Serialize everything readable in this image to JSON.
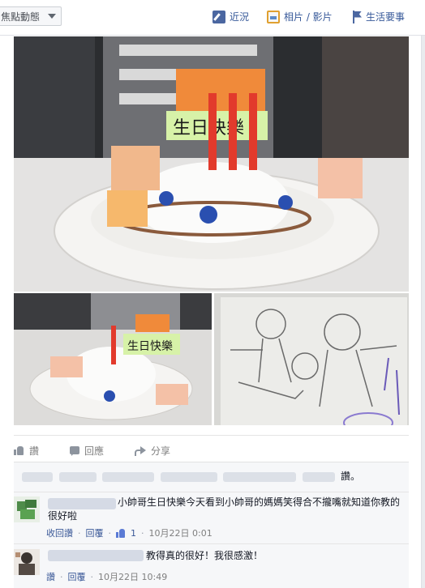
{
  "topbar": {
    "sort_label": "焦點動態",
    "actions": [
      {
        "label": "近況",
        "icon": "pencil-icon"
      },
      {
        "label": "相片 / 影片",
        "icon": "photo-icon"
      },
      {
        "label": "生活要事",
        "icon": "flag-icon"
      }
    ]
  },
  "post": {
    "photos": {
      "main_sign": "生日快樂",
      "small_sign": "生日快樂"
    },
    "actions": {
      "like": "讚",
      "comment": "回應",
      "share": "分享"
    }
  },
  "comments": {
    "likes_summary_tail": "讚。",
    "items": [
      {
        "text": "小帥哥生日快樂今天看到小帥哥的媽媽笑得合不攏嘴就知道你教的很好啦",
        "meta": {
          "action1": "收回讚",
          "action2": "回覆",
          "like_count": "1",
          "time": "10月22日 0:01"
        }
      },
      {
        "text": "教得真的很好！我很感激！",
        "meta": {
          "action1": "讚",
          "action2": "回覆",
          "time": "10月22日 10:49"
        }
      }
    ]
  },
  "colors": {
    "link_blue": "#3b5998",
    "action_blue": "#365899",
    "meta_gray": "#7f7f7f",
    "comment_bg": "#f6f7f9"
  }
}
